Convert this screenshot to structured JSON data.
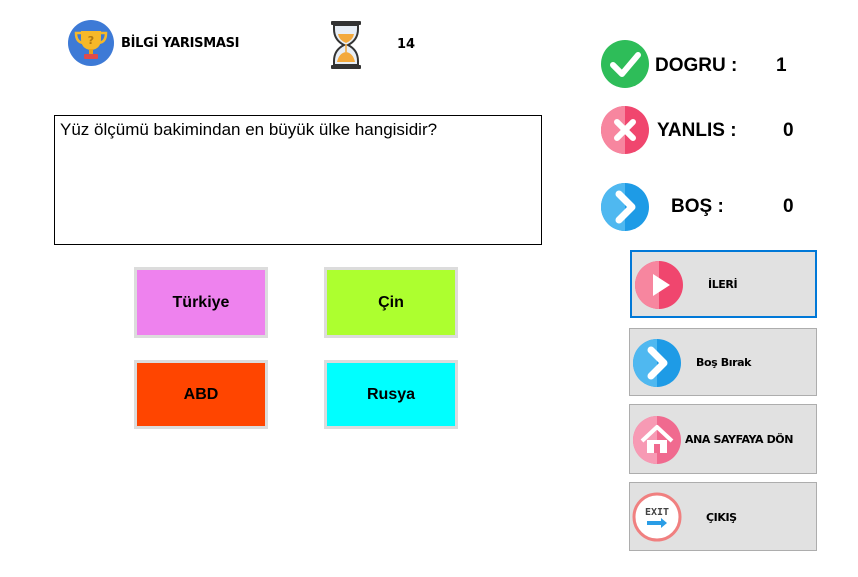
{
  "header": {
    "title": "BİLGİ YARISMASI",
    "timer": "14",
    "logo_icon": "trophy-icon",
    "timer_icon": "hourglass-icon"
  },
  "question": {
    "text": "Yüz ölçümü bakimindan en büyük ülke hangisidir?"
  },
  "answers": [
    {
      "label": "Türkiye",
      "color": "#ee82ee"
    },
    {
      "label": "Çin",
      "color": "#adff2f"
    },
    {
      "label": "ABD",
      "color": "#ff4500"
    },
    {
      "label": "Rusya",
      "color": "#00ffff"
    }
  ],
  "score": {
    "dogru": {
      "label": "DOGRU :",
      "value": "1",
      "icon": "check-circle-icon",
      "color": "#2ebd59"
    },
    "yanlis": {
      "label": "YANLIS :",
      "value": "0",
      "icon": "x-circle-icon",
      "color": "#f0466e"
    },
    "bos": {
      "label": "BOŞ :",
      "value": "0",
      "icon": "chevron-circle-icon",
      "color": "#1e9be6"
    }
  },
  "actions": {
    "ileri": {
      "label": "İLERİ",
      "icon": "play-icon"
    },
    "bos_birak": {
      "label": "Boş Bırak",
      "icon": "chevron-circle-icon"
    },
    "ana_sayfa": {
      "label": "ANA SAYFAYA DÖN",
      "icon": "home-icon"
    },
    "cikis": {
      "label": "ÇIKIŞ",
      "icon": "exit-icon",
      "icon_text": "EXIT"
    }
  }
}
